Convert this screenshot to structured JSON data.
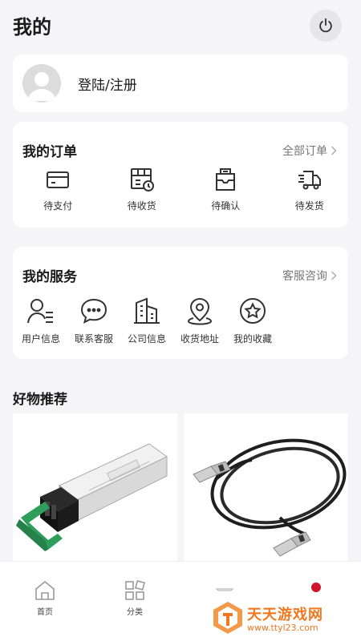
{
  "header": {
    "title": "我的",
    "power_icon": "power-icon"
  },
  "login": {
    "label": "登陆/注册",
    "avatar_icon": "user-avatar-icon"
  },
  "orders": {
    "title": "我的订单",
    "all_link": "全部订单",
    "items": [
      {
        "label": "待支付",
        "icon": "card-icon"
      },
      {
        "label": "待收货",
        "icon": "receive-box-icon"
      },
      {
        "label": "待确认",
        "icon": "inbox-icon"
      },
      {
        "label": "待发货",
        "icon": "truck-icon"
      }
    ]
  },
  "services": {
    "title": "我的服务",
    "support_link": "客服咨询",
    "items": [
      {
        "label": "用户信息",
        "icon": "user-info-icon"
      },
      {
        "label": "联系客服",
        "icon": "chat-bubble-icon"
      },
      {
        "label": "公司信息",
        "icon": "building-icon"
      },
      {
        "label": "收货地址",
        "icon": "location-pin-icon"
      },
      {
        "label": "我的收藏",
        "icon": "star-icon"
      }
    ]
  },
  "recommend": {
    "title": "好物推荐"
  },
  "products": [
    {
      "image": "sfp-transceiver-module"
    },
    {
      "image": "dac-cable-coil"
    }
  ],
  "nav": {
    "home": "首页",
    "category": "分类"
  },
  "watermark": {
    "title": "天天游戏网",
    "url": "www.ttyl23.com"
  },
  "colors": {
    "accent": "#d0142c",
    "watermark": "#f07820",
    "background": "#f5f5f7"
  }
}
